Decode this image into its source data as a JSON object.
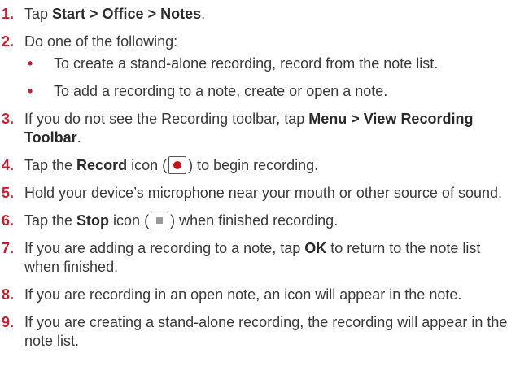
{
  "steps": [
    {
      "num": "1.",
      "parts": [
        "Tap ",
        "Start > Office > Notes",
        "."
      ]
    },
    {
      "num": "2.",
      "text": "Do one of the following:",
      "bullets": [
        "To create a stand-alone recording, record from the note list.",
        "To add a recording to a note, create or open a note."
      ]
    },
    {
      "num": "3.",
      "parts": [
        "If you do not see the Recording toolbar, tap ",
        "Menu > View Recording Toolbar",
        "."
      ]
    },
    {
      "num": "4.",
      "parts": [
        "Tap the ",
        "Record",
        " icon (",
        ") to begin recording."
      ]
    },
    {
      "num": "5.",
      "text": "Hold your device’s microphone near your mouth or other source of sound."
    },
    {
      "num": "6.",
      "parts": [
        "Tap the ",
        "Stop",
        " icon (",
        ") when finished recording."
      ]
    },
    {
      "num": "7.",
      "parts": [
        "If you are adding a recording to a note, tap ",
        "OK",
        " to return to the note list when finished."
      ]
    },
    {
      "num": "8.",
      "text": "If you are recording in an open note, an icon will appear in the note."
    },
    {
      "num": "9.",
      "text": "If you are creating a stand-alone recording, the recording will appear in the note list."
    }
  ],
  "bullet_glyph": "•",
  "icons": {
    "record": "record-icon",
    "stop": "stop-icon"
  },
  "colors": {
    "accent": "#c8202f",
    "text": "#3a3a3a",
    "record_dot": "#c4151c",
    "stop_square": "#9a9a9a"
  }
}
